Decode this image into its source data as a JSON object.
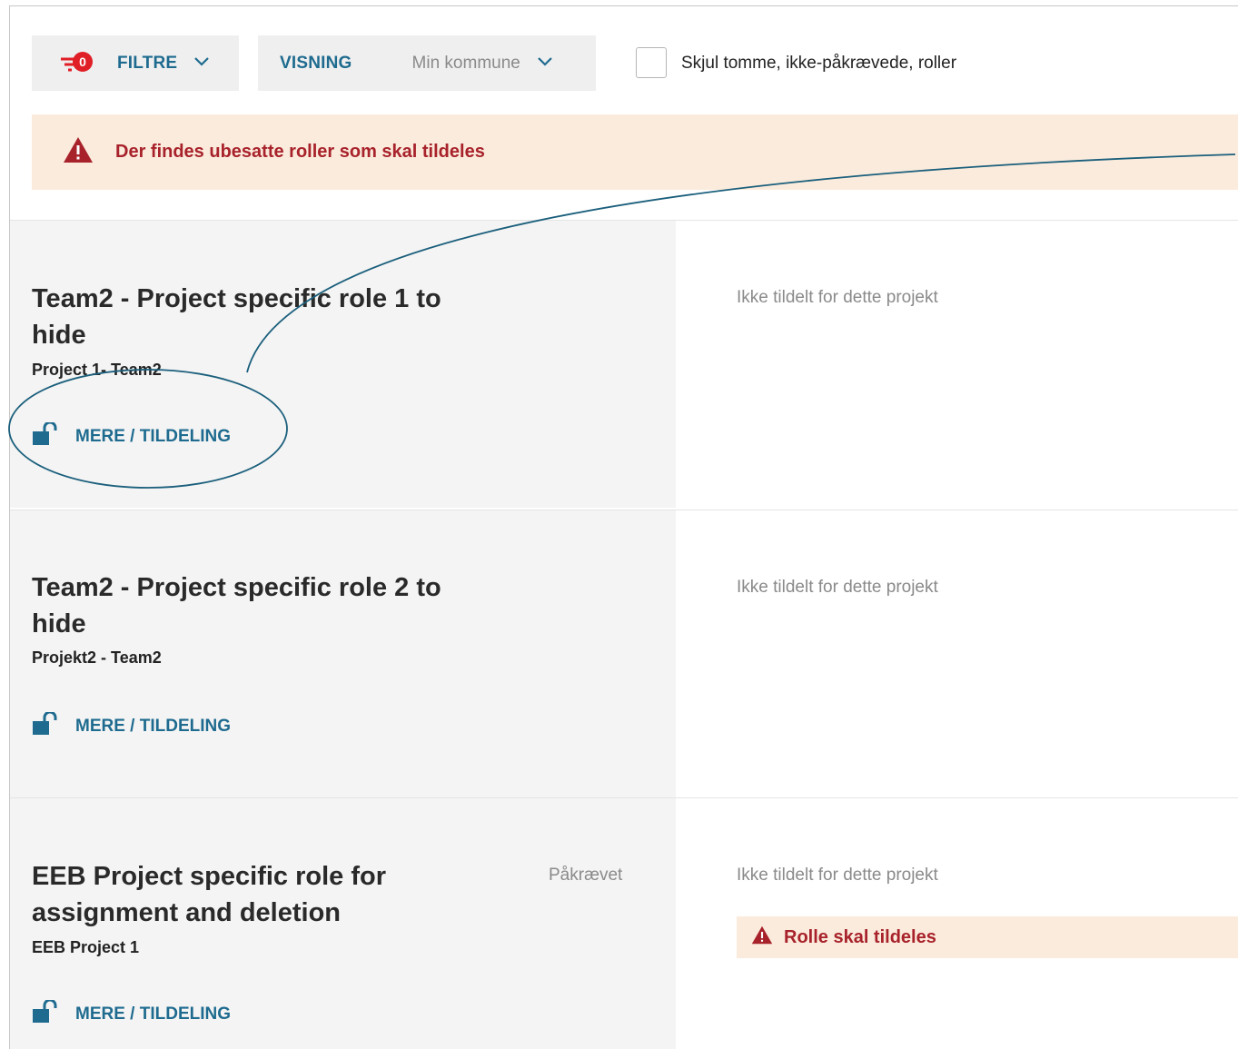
{
  "toolbar": {
    "filter": {
      "label": "FILTRE",
      "badge_count": "0",
      "icon": "filter-icon"
    },
    "view": {
      "label": "VISNING",
      "value": "Min kommune"
    },
    "hide_empty": {
      "label": "Skjul tomme, ikke-påkrævede, roller",
      "checked": false
    }
  },
  "alert": {
    "text": "Der findes ubesatte roller som skal tildeles",
    "icon": "warning-icon",
    "color": "#a8222b"
  },
  "roles": [
    {
      "title_line1": "Team2 - Project specific role 1 to",
      "title_line2": "hide",
      "project": "Project 1- Team2",
      "more_label": "MERE / TILDELING",
      "required": "",
      "status": "Ikke tildelt for dette projekt",
      "status_alert": ""
    },
    {
      "title_line1": "Team2 - Project specific role 2 to",
      "title_line2": "hide",
      "project": "Projekt2 - Team2",
      "more_label": "MERE / TILDELING",
      "required": "",
      "status": "Ikke tildelt for dette projekt",
      "status_alert": ""
    },
    {
      "title_line1": "EEB Project specific role for",
      "title_line2": "assignment and deletion",
      "project": "EEB Project 1",
      "more_label": "MERE / TILDELING",
      "required": "Påkrævet",
      "status": "Ikke tildelt for dette projekt",
      "status_alert": "Rolle skal tildeles"
    }
  ],
  "colors": {
    "accent": "#1e6b8f",
    "danger": "#a8222b",
    "alert_bg": "#fbebdc",
    "row_bg": "#f4f4f4",
    "badge": "#e01e26"
  }
}
